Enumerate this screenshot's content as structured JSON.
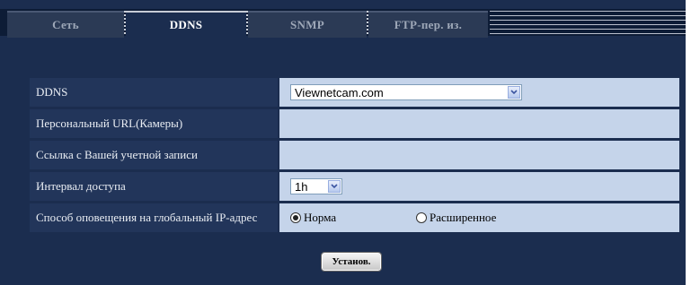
{
  "tabs": [
    {
      "label": "Сеть",
      "active": false
    },
    {
      "label": "DDNS",
      "active": true
    },
    {
      "label": "SNMP",
      "active": false
    },
    {
      "label": "FTP-пер. из.",
      "active": false
    }
  ],
  "rows": {
    "ddns": {
      "label": "DDNS",
      "value": "Viewnetcam.com"
    },
    "personal_url": {
      "label": "Персональный URL(Камеры)",
      "value": ""
    },
    "account_link": {
      "label": "Ссылка с Вашей учетной записи",
      "value": ""
    },
    "access_interval": {
      "label": "Интервал доступа",
      "value": "1h"
    },
    "ip_notify": {
      "label": "Способ оповещения на глобальный IP-адрес",
      "options": [
        {
          "label": "Норма",
          "selected": true
        },
        {
          "label": "Расширенное",
          "selected": false
        }
      ]
    }
  },
  "set_button": "Установ.",
  "colors": {
    "frame_bg": "#1b2d4f",
    "label_bg": "#22355a",
    "value_bg": "#c5d4ea"
  }
}
